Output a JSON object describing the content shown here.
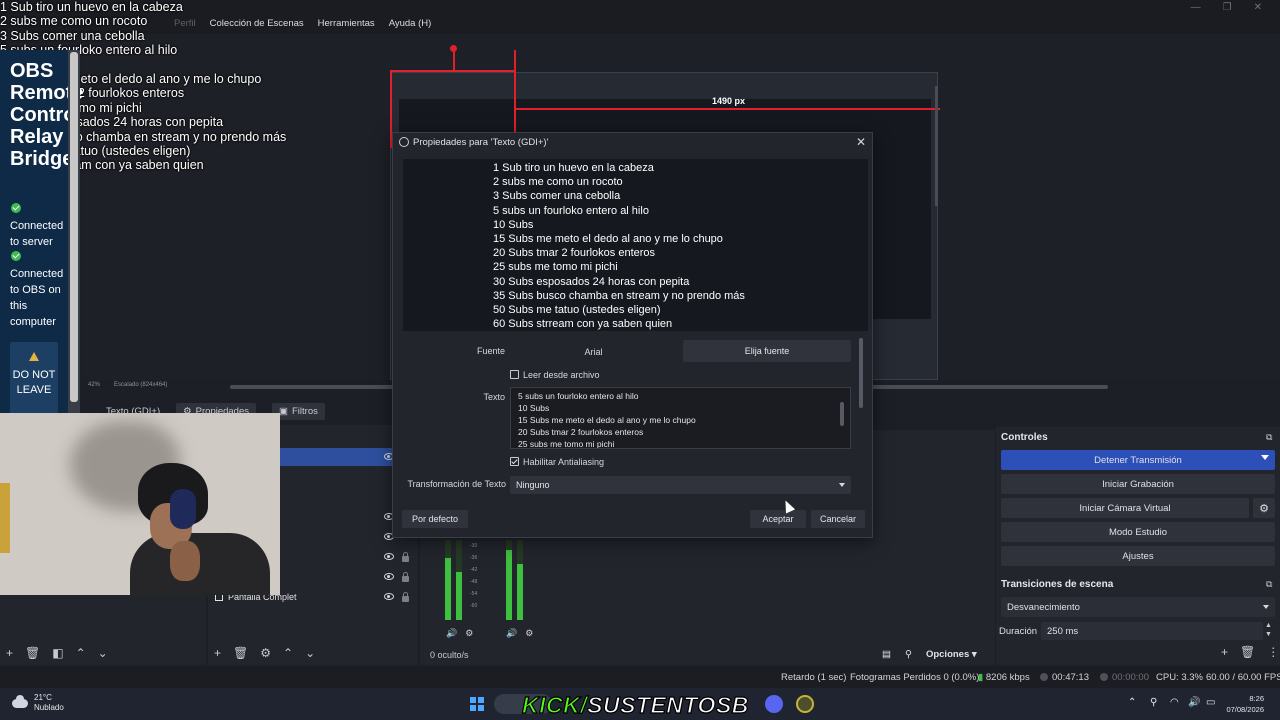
{
  "overlay_subs": [
    "1 Sub tiro un huevo en la cabeza",
    "2 subs me como un rocoto",
    "3 Subs comer una cebolla",
    "5 subs un fourloko entero al hilo",
    "10 Subs",
    "15 Subs me meto el dedo al ano y me lo chupo",
    "20 Subs tmar 2 fourlokos enteros",
    "25 subs me tomo mi pichi",
    "30 Subs esposados 24 horas con pepita",
    "35 Subs busco chamba en stream y no prendo más",
    "50 Subs me tatuo (ustedes eligen)",
    "60 Subs strream con ya saben quien"
  ],
  "menubar": {
    "items": [
      "Perfil",
      "Colección de Escenas",
      "Herramientas",
      "Ayuda (H)"
    ]
  },
  "remote_panel": {
    "title_lines": [
      "OBS",
      "Remote",
      "Control",
      "Relay",
      "Bridge"
    ],
    "status1": "Connected to server",
    "status2": "Connected to OBS on this computer",
    "warning": "DO NOT LEAVE"
  },
  "preview": {
    "width_label": "1490 px",
    "zoom": "42%",
    "scale": "Escalado (824x464)"
  },
  "docks": {
    "source_tab": "Texto (GDI+)",
    "properties_tab": "Propiedades",
    "filters_tab": "Filtros",
    "source_item": "Pantalla Complet",
    "hidden_count": "0 oculto/s",
    "options_label": "Opciones"
  },
  "controls": {
    "title": "Controles",
    "stop_stream": "Detener Transmisión",
    "start_record": "Iniciar Grabación",
    "start_virtualcam": "Iniciar Cámara Virtual",
    "studio_mode": "Modo Estudio",
    "settings": "Ajustes"
  },
  "transitions": {
    "title": "Transiciones de escena",
    "selected": "Desvanecimiento",
    "duration_label": "Duración",
    "duration_value": "250 ms"
  },
  "statusbar": {
    "delay": "Retardo (1 sec)",
    "dropped": "Fotogramas Perdidos 0 (0.0%)",
    "bitrate": "8206 kbps",
    "stream_time": "00:47:13",
    "record_time": "00:00:00",
    "cpu": "CPU: 3.3%",
    "fps": "60.00 / 60.00 FPS"
  },
  "taskbar": {
    "weather_temp": "21°C",
    "weather_desc": "Nublado",
    "time": "8:26",
    "date": "07/08/2026",
    "banner_a": "KICK/",
    "banner_b": "SUSTENTOSB"
  },
  "modal": {
    "title": "Propiedades para 'Texto (GDI+)'",
    "preview_lines": [
      "1 Sub tiro un huevo en la cabeza",
      "2 subs me como un rocoto",
      "3 Subs comer una cebolla",
      "5 subs un fourloko entero al hilo",
      "10 Subs",
      "15 Subs me meto el dedo al ano y me lo chupo",
      "20 Subs tmar 2 fourlokos enteros",
      "25 subs me tomo mi pichi",
      "30 Subs esposados 24 horas con pepita",
      "35 Subs busco chamba en stream y no prendo más",
      "50 Subs me tatuo (ustedes eligen)",
      "60 Subs strream con ya saben quien"
    ],
    "font_label": "Fuente",
    "font_value": "Arial",
    "font_button": "Elija fuente",
    "read_file_label": "Leer desde archivo",
    "text_label": "Texto",
    "text_lines": [
      "5 subs un fourloko entero al hilo",
      "10 Subs",
      "15 Subs me meto el dedo al ano y me lo chupo",
      "20 Subs tmar 2 fourlokos enteros",
      "25 subs me tomo mi pichi"
    ],
    "antialias_label": "Habilitar Antialiasing",
    "transform_label": "Transformación de Texto",
    "transform_value": "Ninguno",
    "defaults_button": "Por defecto",
    "accept_button": "Aceptar",
    "cancel_button": "Cancelar"
  },
  "colors": {
    "accent": "#2c4fb8",
    "remote_bg": "#0e2a47",
    "guide_red": "#e0202b",
    "meter_green": "#3fbf3f",
    "kick_green": "#53fc18"
  }
}
